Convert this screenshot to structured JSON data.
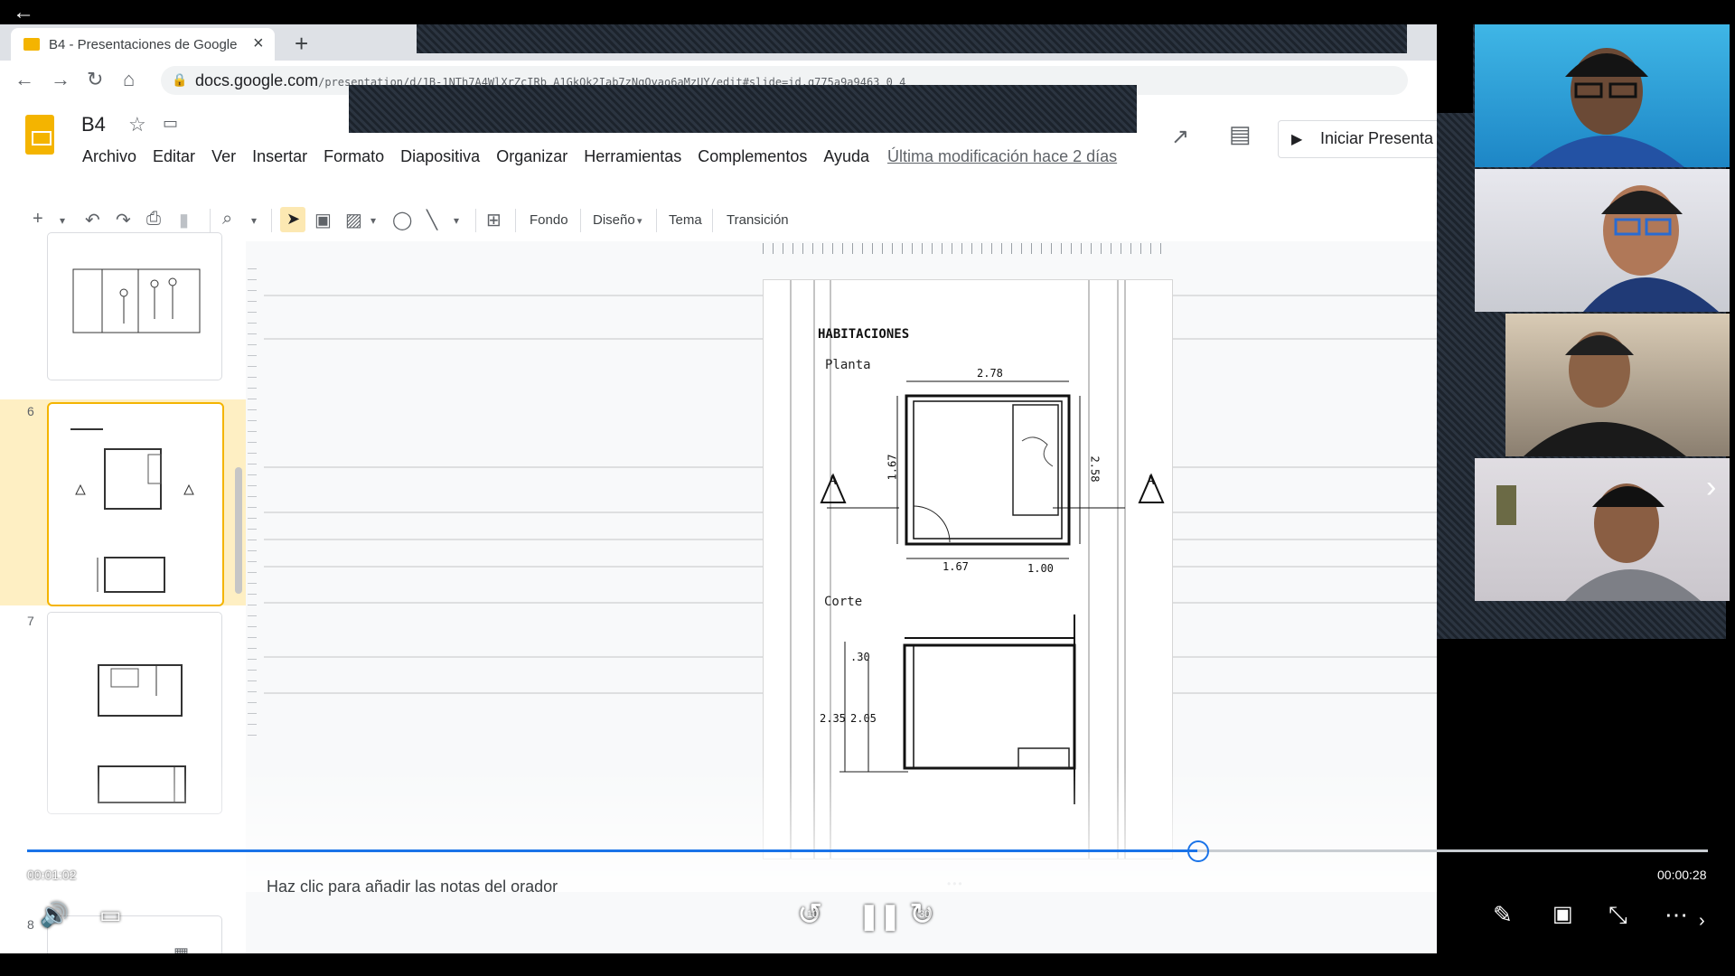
{
  "browser": {
    "tab_title": "B4 - Presentaciones de Google",
    "tab_close": "×",
    "new_tab": "+",
    "url_host": "docs.google.com",
    "url_path": "/presentation/d/1B-1NTh7A4WlXrZcIRb_A1GkOk2Iab7zNqOyao6aMzUY/edit#slide=id.g775a9a9463_0_4"
  },
  "docs": {
    "title": "B4",
    "menu": [
      "Archivo",
      "Editar",
      "Ver",
      "Insertar",
      "Formato",
      "Diapositiva",
      "Organizar",
      "Herramientas",
      "Complementos",
      "Ayuda"
    ],
    "last_edit": "Última modificación hace 2 días",
    "present_label": "Iniciar Presenta"
  },
  "toolbar": {
    "background": "Fondo",
    "layout": "Diseño",
    "theme": "Tema",
    "transition": "Transición"
  },
  "filmstrip": {
    "slide_numbers": [
      "6",
      "7",
      "8"
    ]
  },
  "slide": {
    "title": "HABITACIONES",
    "planta_label": "Planta",
    "corte_label": "Corte",
    "dims": {
      "top_width": "2.78",
      "left_height": "1.67",
      "right_height": "2.58",
      "bottom_left": "1.67",
      "bottom_right": "1.00",
      "corte_top": ".30",
      "corte_total": "2.35",
      "corte_inner": "2.05",
      "section_marker": "A"
    }
  },
  "notes_placeholder": "Haz clic para añadir las notas del orador",
  "video": {
    "elapsed": "00:01:02",
    "remaining": "00:00:28",
    "progress_fraction": 0.696,
    "rewind_label": "10",
    "forward_label": "30"
  },
  "colors": {
    "accent": "#1a73e8",
    "slides_yellow": "#f4b400",
    "active_slide_bg": "#feefc3"
  }
}
